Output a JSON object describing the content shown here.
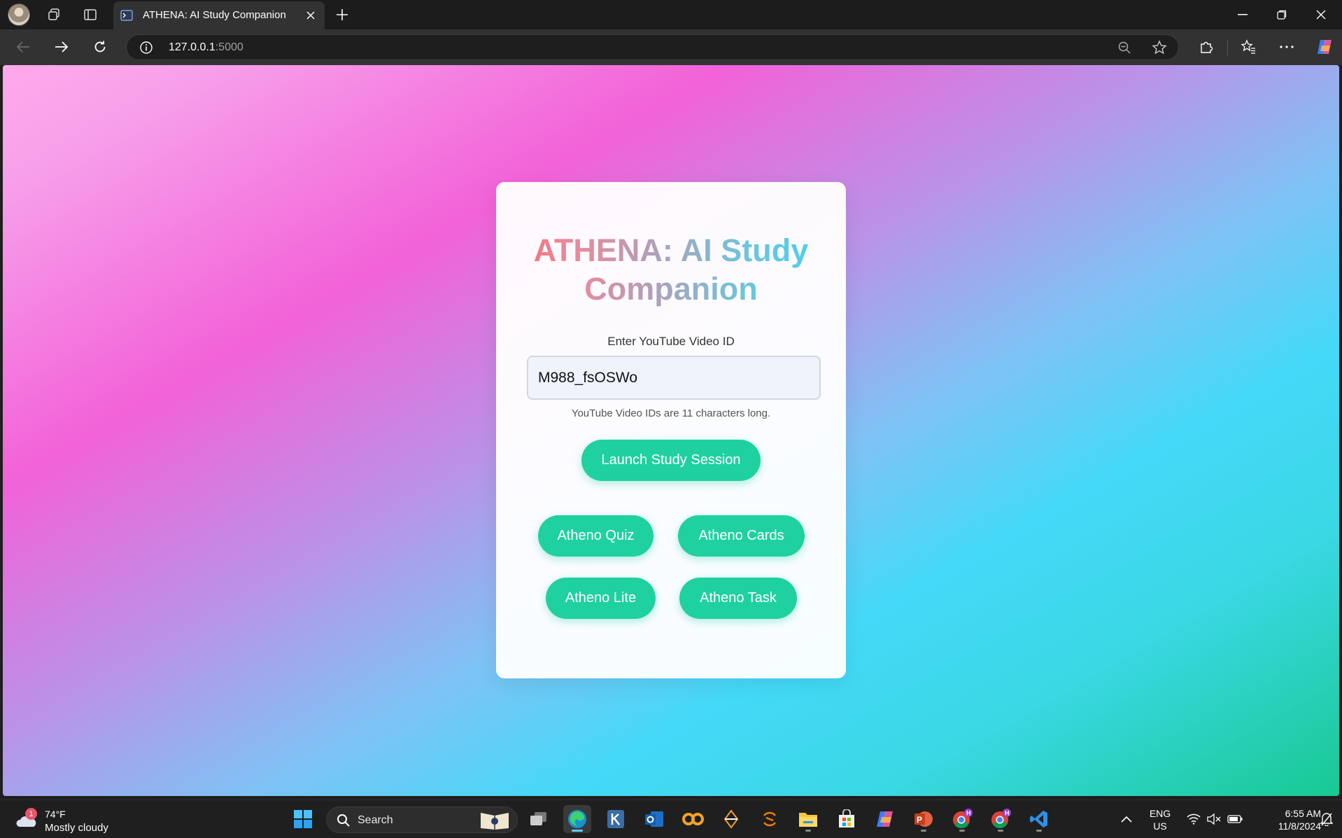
{
  "browser": {
    "tab_title": "ATHENA: AI Study Companion",
    "url_host": "127.0.0.1",
    "url_port": ":5000"
  },
  "page": {
    "title": "ATHENA: AI Study Companion",
    "input_label": "Enter YouTube Video ID",
    "input_value": "M988_fsOSWo",
    "hint": "YouTube Video IDs are 11 characters long.",
    "launch_button": "Launch Study Session",
    "buttons": {
      "quiz": "Atheno Quiz",
      "cards": "Atheno Cards",
      "lite": "Atheno Lite",
      "task": "Atheno Task"
    },
    "colors": {
      "button": "#1fd1a0",
      "title_gradient_start": "#f46a6a",
      "title_gradient_end": "#40d4f2"
    }
  },
  "taskbar": {
    "weather_temp": "74°F",
    "weather_desc": "Mostly cloudy",
    "weather_badge": "1",
    "search_label": "Search",
    "lang": "ENG",
    "region": "US",
    "time": "6:55 AM",
    "date": "11/8/2024",
    "chrome_badge": "H"
  }
}
